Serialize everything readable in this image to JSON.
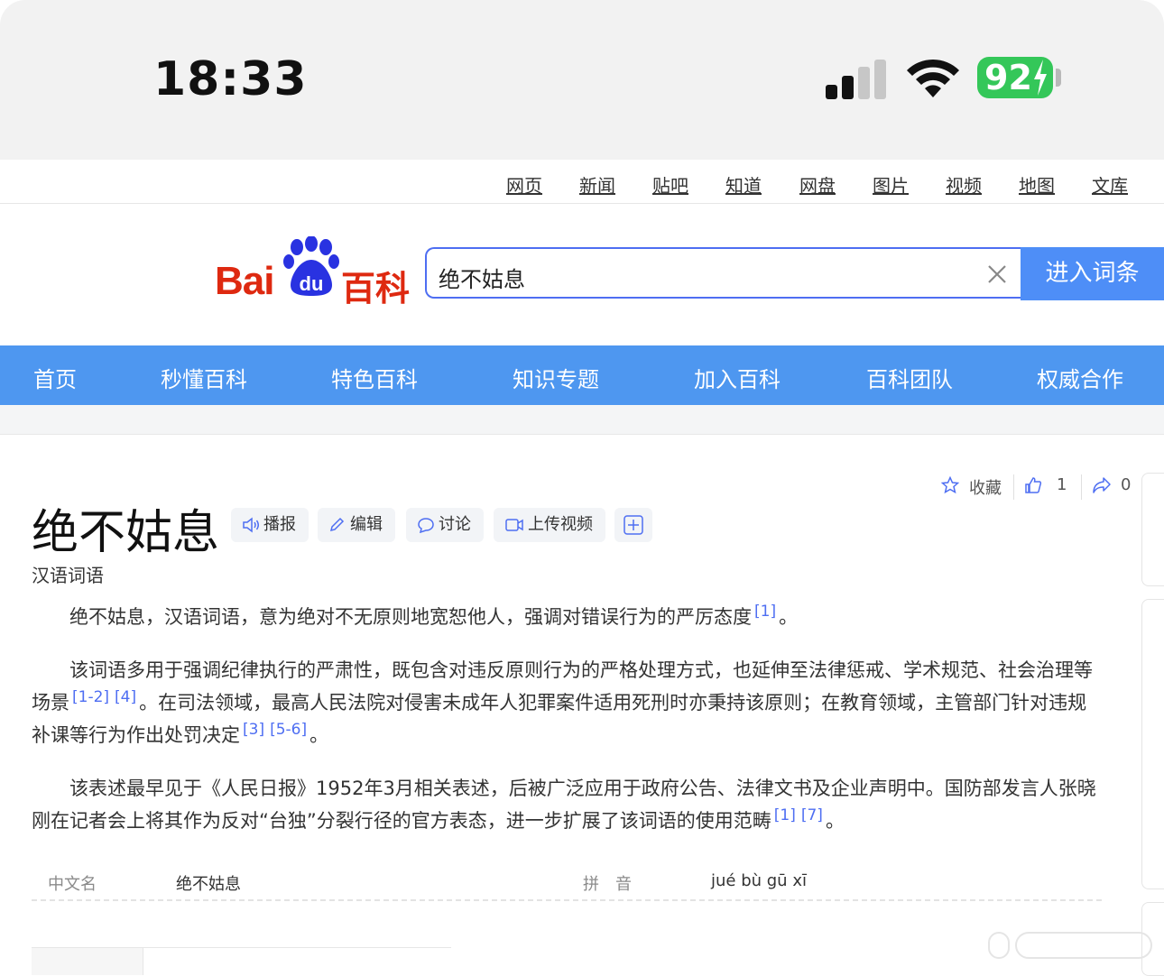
{
  "status_bar": {
    "time": "18:33",
    "battery": "92"
  },
  "top_links": [
    "网页",
    "新闻",
    "贴吧",
    "知道",
    "网盘",
    "图片",
    "视频",
    "地图",
    "文库"
  ],
  "logo": {
    "bai": "Bai",
    "du": "du",
    "baike": "百科"
  },
  "search": {
    "value": "绝不姑息",
    "button": "进入词条"
  },
  "nav": [
    "首页",
    "秒懂百科",
    "特色百科",
    "知识专题",
    "加入百科",
    "百科团队",
    "权威合作"
  ],
  "article": {
    "title": "绝不姑息",
    "tools": [
      "播报",
      "编辑",
      "讨论",
      "上传视频"
    ],
    "subtitle": "汉语词语",
    "actions": {
      "favorite": "收藏",
      "likes": "1",
      "shares": "0"
    },
    "p1": {
      "text": "绝不姑息，汉语词语，意为绝对不无原则地宽恕他人，强调对错误行为的严厉态度",
      "ref1": "[1]",
      "end": "。"
    },
    "p2": {
      "a": "该词语多用于强调纪律执行的严肃性，既包含对违反原则行为的严格处理方式，也延伸至法律惩戒、学术规范、社会治理等场景",
      "ref1": "[1-2]",
      "ref2": "[4]",
      "b": "。在司法领域，最高人民法院对侵害未成年人犯罪案件适用死刑时亦秉持该原则；在教育领域，主管部门针对违规补课等行为作出处罚决定",
      "ref3": "[3]",
      "ref4": "[5-6]",
      "end": "。"
    },
    "p3": {
      "a": "该表述最早见于《人民日报》1952年3月相关表述，后被广泛应用于政府公告、法律文书及企业声明中。国防部发言人张晓刚在记者会上将其作为反对“台独”分裂行径的官方表态，进一步扩展了该词语的使用范畴",
      "ref1": "[1]",
      "ref2": "[7]",
      "end": "。"
    },
    "infobox": {
      "k1": "中文名",
      "v1": "绝不姑息",
      "k2": "拼　音",
      "v2": "jué bù gū xī"
    }
  },
  "colors": {
    "brand_red": "#de2910",
    "nav_blue": "#4e97f0",
    "link_blue": "#4e6ef2"
  },
  "icons": [
    "speaker-icon",
    "pencil-icon",
    "chat-icon",
    "video-icon",
    "plus-icon",
    "star-icon",
    "thumbs-up-icon",
    "share-icon",
    "clear-icon"
  ]
}
